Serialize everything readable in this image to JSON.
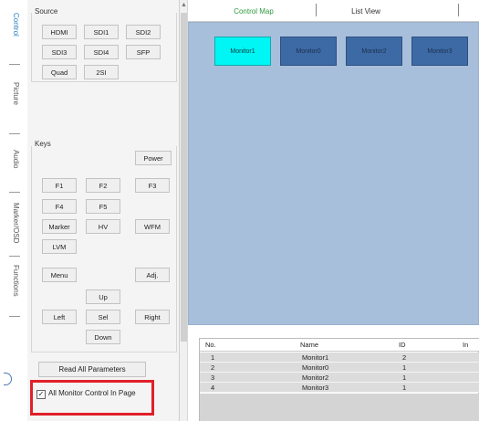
{
  "vertical_tabs": [
    {
      "label": "Control",
      "active": true
    },
    {
      "label": "Picture",
      "active": false
    },
    {
      "label": "Audio",
      "active": false
    },
    {
      "label": "Marker/OSD",
      "active": false
    },
    {
      "label": "Functions",
      "active": false
    }
  ],
  "source": {
    "label": "Source",
    "buttons": [
      "HDMI",
      "SDI1",
      "SDI2",
      "SDI3",
      "SDI4",
      "SFP",
      "Quad",
      "2SI"
    ]
  },
  "keys": {
    "label": "Keys",
    "power": "Power",
    "f1": "F1",
    "f2": "F2",
    "f3": "F3",
    "f4": "F4",
    "f5": "F5",
    "marker": "Marker",
    "hv": "HV",
    "wfm": "WFM",
    "lvm": "LVM",
    "menu": "Menu",
    "adj": "Adj.",
    "up": "Up",
    "left": "Left",
    "sel": "Sel",
    "right": "Right",
    "down": "Down"
  },
  "read_all_label": "Read All Parameters",
  "all_monitor_control": {
    "label": "All Monitor Control In Page",
    "checked": true,
    "check_glyph": "✓"
  },
  "tabs": {
    "control_map": "Control Map",
    "list_view": "List View"
  },
  "monitors": [
    {
      "label": "Monitor1",
      "selected": true
    },
    {
      "label": "Monitor0",
      "selected": false
    },
    {
      "label": "Monitor2",
      "selected": false
    },
    {
      "label": "Monitor3",
      "selected": false
    }
  ],
  "table": {
    "headers": {
      "no": "No.",
      "name": "Name",
      "id": "ID",
      "in": "In"
    },
    "rows": [
      {
        "no": "1",
        "name": "Monitor1",
        "id": "2"
      },
      {
        "no": "2",
        "name": "Monitor0",
        "id": "1"
      },
      {
        "no": "3",
        "name": "Monitor2",
        "id": "1"
      },
      {
        "no": "4",
        "name": "Monitor3",
        "id": "1"
      }
    ]
  },
  "colors": {
    "map_background": "#a8bfdc",
    "monitor_tile": "#3d6aa4",
    "monitor_selected": "#00f5f5",
    "active_tab_text": "#2e9a3e",
    "highlight_box": "#e0202a"
  },
  "icons": {
    "scroll_up": "▲"
  }
}
